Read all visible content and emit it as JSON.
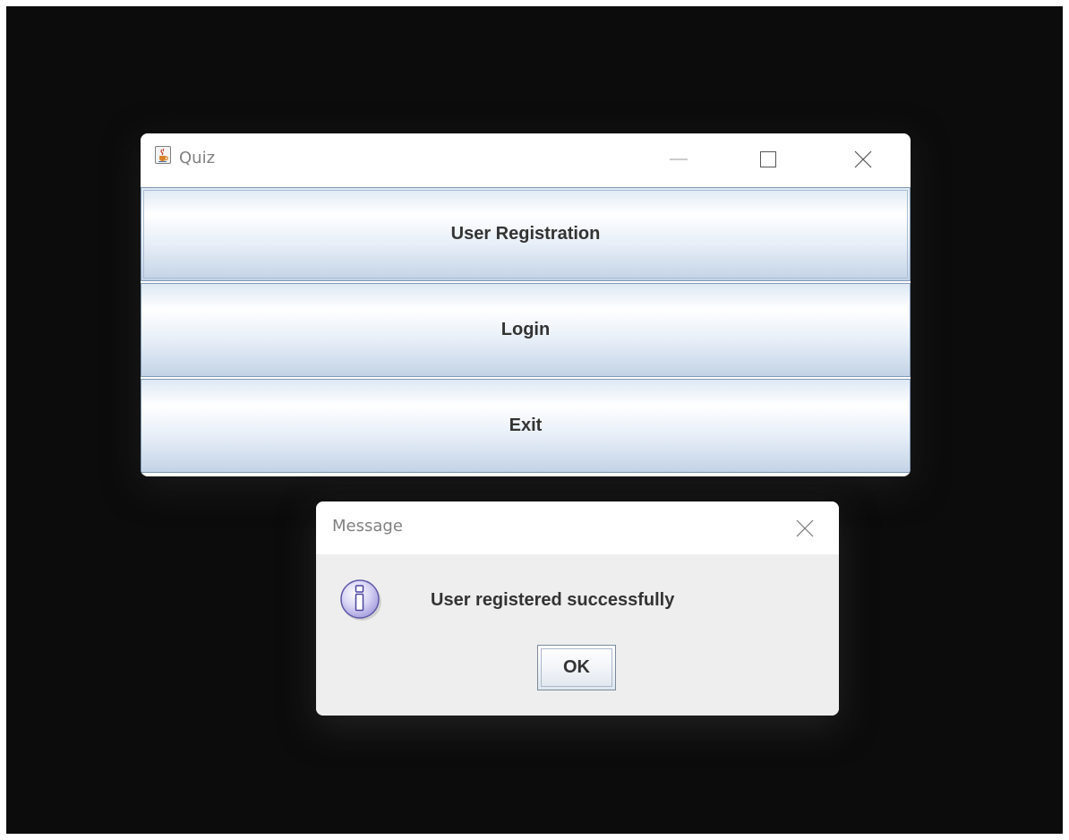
{
  "screen": {
    "background_color": "#0c0c0c"
  },
  "main_window": {
    "title": "Quiz",
    "app_icon": "java-cup-icon",
    "controls": {
      "minimize_icon": "minimize-icon",
      "maximize_icon": "maximize-icon",
      "close_icon": "close-icon"
    },
    "buttons": [
      {
        "label": "User Registration",
        "focused": true
      },
      {
        "label": "Login",
        "focused": false
      },
      {
        "label": "Exit",
        "focused": false
      }
    ],
    "button_gradient_colors": [
      "#dde8f3",
      "#ffffff",
      "#c3d3e6"
    ],
    "button_border_color": "#7f99b6"
  },
  "dialog": {
    "title": "Message",
    "close_icon": "close-icon",
    "icon": "information-icon",
    "message": "User registered successfully",
    "ok_label": "OK",
    "background_color": "#eeeeee"
  }
}
